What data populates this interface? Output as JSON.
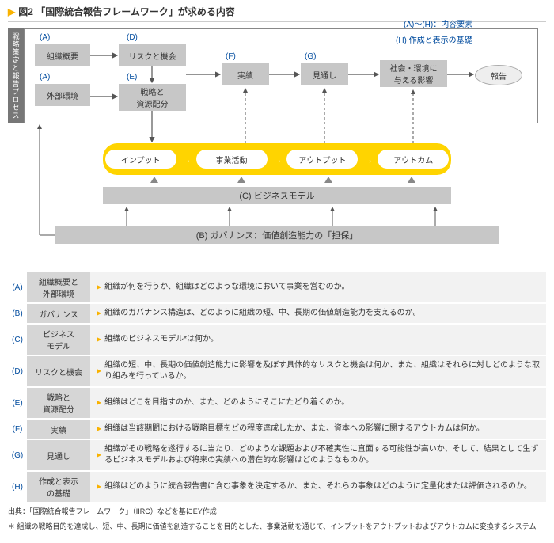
{
  "title": "図2 「国際統合報告フレームワーク」が求める内容",
  "side_label": "戦略策定と報告プロセス",
  "legend_elements": "(A)～(H)：内容要素",
  "top": {
    "A1": "(A)",
    "A2": "(A)",
    "D": "(D)",
    "E": "(E)",
    "F": "(F)",
    "G": "(G)",
    "H_lbl": "(H) 作成と表示の基礎",
    "org_overview": "組織概要",
    "ext_env": "外部環境",
    "risk_opp": "リスクと機会",
    "strategy_alloc": "戦略と\n資源配分",
    "performance": "実績",
    "outlook": "見通し",
    "soc_env_impact": "社会・環境に\n与える影響",
    "report": "報告"
  },
  "yellow": {
    "in": "インプット",
    "act": "事業活動",
    "out": "アウトプット",
    "come": "アウトカム"
  },
  "biz_model": "(C) ビジネスモデル",
  "governance": "(B) ガバナンス：価値創造能力の「担保」",
  "rows": [
    {
      "k": "(A)",
      "l": "組織概要と\n外部環境",
      "d": "組織が何を行うか、組織はどのような環境において事業を営むのか。"
    },
    {
      "k": "(B)",
      "l": "ガバナンス",
      "d": "組織のガバナンス構造は、どのように組織の短、中、長期の価値創造能力を支えるのか。"
    },
    {
      "k": "(C)",
      "l": "ビジネス\nモデル",
      "d": "組織のビジネスモデル*は何か。"
    },
    {
      "k": "(D)",
      "l": "リスクと機会",
      "d": "組織の短、中、長期の価値創造能力に影響を及ぼす具体的なリスクと機会は何か、また、組織はそれらに対しどのような取り組みを行っているか。"
    },
    {
      "k": "(E)",
      "l": "戦略と\n資源配分",
      "d": "組織はどこを目指すのか、また、どのようにそこにたどり着くのか。"
    },
    {
      "k": "(F)",
      "l": "実績",
      "d": "組織は当該期間における戦略目標をどの程度達成したか、また、資本への影響に関するアウトカムは何か。"
    },
    {
      "k": "(G)",
      "l": "見通し",
      "d": "組織がその戦略を遂行するに当たり、どのような課題および不確実性に直面する可能性が高いか、そして、結果として生ずるビジネスモデルおよび将来の実績への潜在的な影響はどのようなものか。"
    },
    {
      "k": "(H)",
      "l": "作成と表示\nの基礎",
      "d": "組織はどのように統合報告書に含む事象を決定するか、また、それらの事象はどのように定量化または評価されるのか。"
    }
  ],
  "source": "出典：「国際統合報告フレームワーク」（IIRC）などを基にEY作成",
  "footnote": "＊ 組織の戦略目的を達成し、短、中、長期に価値を創造することを目的とした、事業活動を通じて、インプットをアウトプットおよびアウトカムに変換するシステム"
}
